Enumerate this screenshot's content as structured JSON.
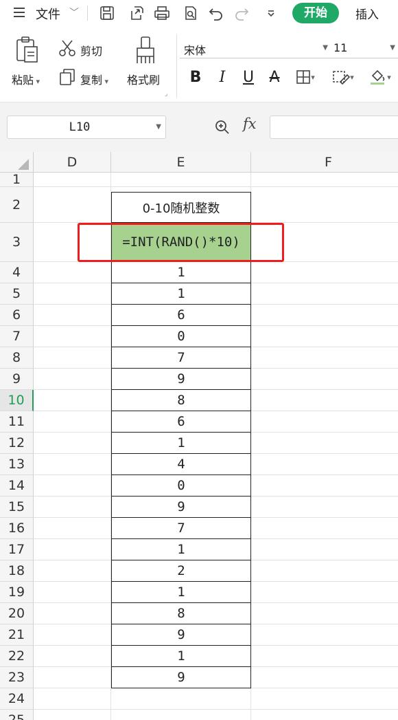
{
  "menubar": {
    "file_label": "文件",
    "file_chevron": "﹀",
    "quick_icons": [
      "save-icon",
      "export-icon",
      "print-icon",
      "print-preview-icon",
      "undo-icon",
      "redo-icon",
      "more-dropdown-icon"
    ],
    "tabs": {
      "start": "开始",
      "insert": "插入"
    }
  },
  "ribbon": {
    "paste_label": "粘贴",
    "cut_label": "剪切",
    "copy_label": "复制",
    "format_painter_label": "格式刷",
    "font_name": "宋体",
    "font_size": "11",
    "format_buttons": {
      "bold": "B",
      "italic": "I",
      "underline": "U",
      "strikethrough": "A"
    }
  },
  "formula_bar": {
    "name_box": "L10",
    "fx_label": "fx",
    "formula_value": ""
  },
  "sheet": {
    "columns": [
      "D",
      "E",
      "F"
    ],
    "rows": [
      "1",
      "2",
      "3",
      "4",
      "5",
      "6",
      "7",
      "8",
      "9",
      "10",
      "11",
      "12",
      "13",
      "14",
      "15",
      "16",
      "17",
      "18",
      "19",
      "20",
      "21",
      "22",
      "23",
      "24",
      "25"
    ],
    "active_row": "10",
    "header_cell": "0-10随机整数",
    "formula_cell": "=INT(RAND()*10)",
    "values": [
      "1",
      "1",
      "6",
      "0",
      "7",
      "9",
      "8",
      "6",
      "1",
      "4",
      "0",
      "9",
      "7",
      "1",
      "2",
      "1",
      "8",
      "9",
      "1",
      "9"
    ]
  },
  "colors": {
    "accent_green": "#1fa866",
    "formula_cell_fill": "#a6d18f",
    "highlight_border": "#ee1c1c"
  }
}
